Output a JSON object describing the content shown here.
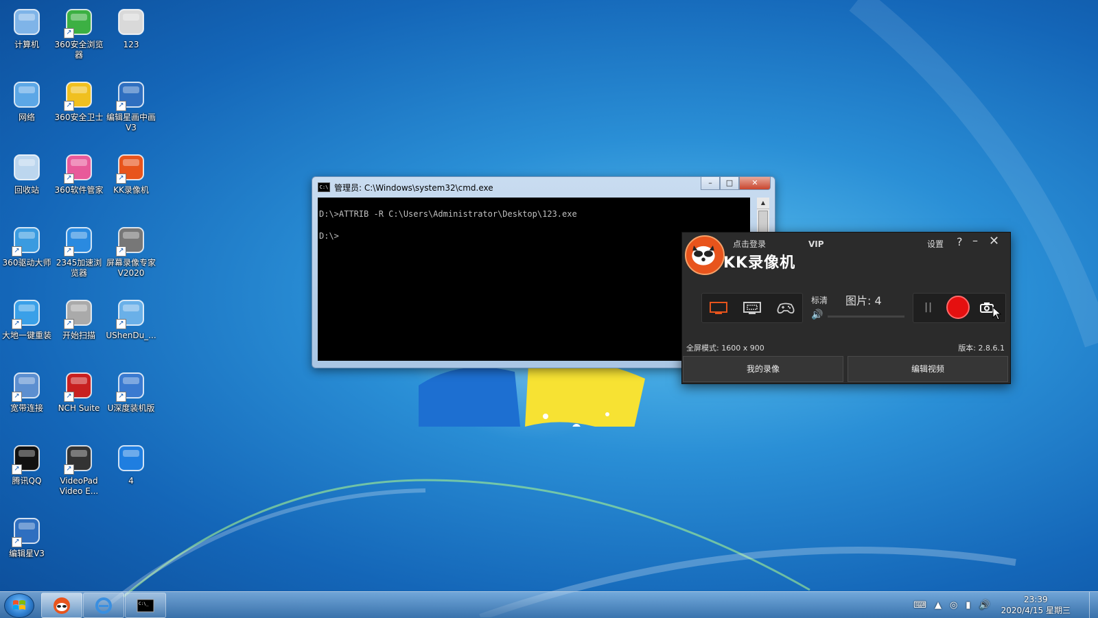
{
  "desktop": {
    "icons": [
      {
        "label": "计算机",
        "icon": "computer-icon"
      },
      {
        "label": "360安全浏览器",
        "icon": "browser-360-icon"
      },
      {
        "label": "123",
        "icon": "disc-icon"
      },
      {
        "label": "网络",
        "icon": "network-icon"
      },
      {
        "label": "360安全卫士",
        "icon": "security-360-icon"
      },
      {
        "label": "编辑星画中画V3",
        "icon": "video-edit-icon"
      },
      {
        "label": "回收站",
        "icon": "recycle-bin-icon"
      },
      {
        "label": "360软件管家",
        "icon": "software-manager-icon"
      },
      {
        "label": "KK录像机",
        "icon": "kk-recorder-icon"
      },
      {
        "label": "360驱动大师",
        "icon": "driver-master-icon"
      },
      {
        "label": "2345加速浏览器",
        "icon": "browser-2345-icon"
      },
      {
        "label": "屏幕录像专家V2020",
        "icon": "screen-recorder-icon"
      },
      {
        "label": "大地一键重装",
        "icon": "dadi-reinstall-icon"
      },
      {
        "label": "开始扫描",
        "icon": "scan-icon"
      },
      {
        "label": "UShenDu_...",
        "icon": "ushendu-icon"
      },
      {
        "label": "宽带连接",
        "icon": "broadband-icon"
      },
      {
        "label": "NCH Suite",
        "icon": "nch-icon"
      },
      {
        "label": "U深度装机版",
        "icon": "usb-install-icon"
      },
      {
        "label": "腾讯QQ",
        "icon": "qq-icon"
      },
      {
        "label": "VideoPad Video E...",
        "icon": "videopad-icon"
      },
      {
        "label": "4",
        "icon": "video-file-icon"
      },
      {
        "label": "编辑星V3",
        "icon": "video-edit-v3-icon"
      }
    ]
  },
  "cmd": {
    "title": "管理员: C:\\Windows\\system32\\cmd.exe",
    "line1": "D:\\>ATTRIB -R C:\\Users\\Administrator\\Desktop\\123.exe",
    "line2": "D:\\>"
  },
  "kk": {
    "login": "点击登录",
    "vip": "VIP",
    "title": "KK录像机",
    "settings": "设置",
    "help": "?",
    "quality": "标清",
    "pictures": "图片: 4",
    "mode_text": "全屏模式: 1600 x 900",
    "version": "版本: 2.8.6.1",
    "my_recordings": "我的录像",
    "edit_video": "编辑视频",
    "accent": "#e8541c",
    "record_color": "#e51010"
  },
  "taskbar": {
    "time": "23:39",
    "date": "2020/4/15 星期三"
  }
}
